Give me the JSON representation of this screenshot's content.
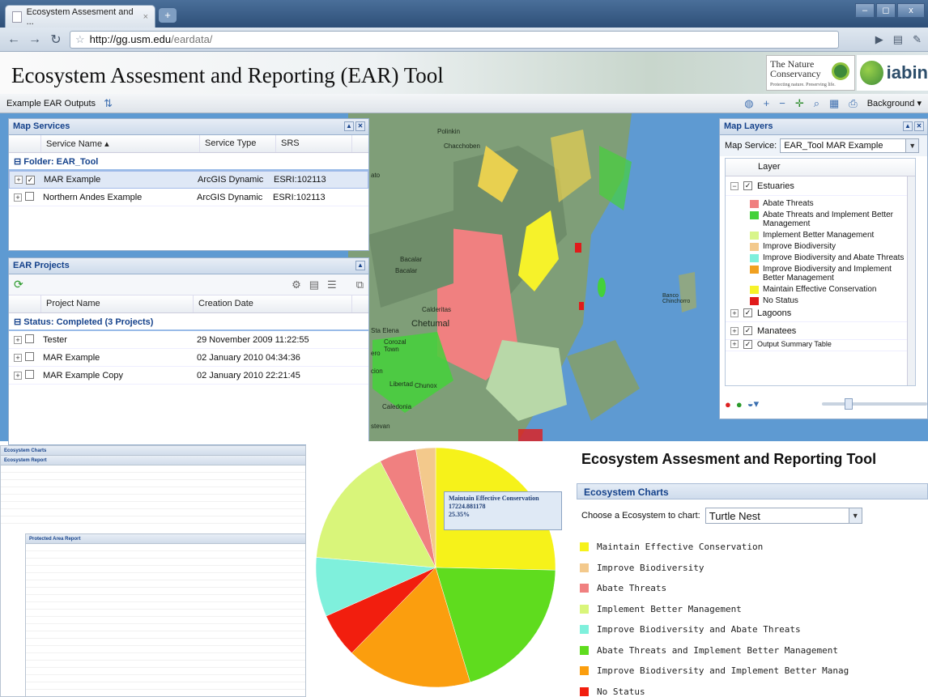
{
  "browser": {
    "tab_title": "Ecosystem Assesment and ...",
    "tab_close": "×",
    "new_tab": "+",
    "window_controls": {
      "minimize": "–",
      "maximize": "◻",
      "close": "x"
    },
    "url_host": "http://gg.usm.edu",
    "url_path": "/eardata/"
  },
  "app": {
    "title": "Ecosystem Assesment and Reporting (EAR) Tool",
    "logos": {
      "tnc_line1": "The Nature",
      "tnc_line2": "Conservancy",
      "tnc_tag": "Protecting nature. Preserving life.",
      "iabin": "iabin"
    },
    "toolbar": {
      "example_outputs": "Example EAR Outputs",
      "background": "Background ▾"
    }
  },
  "map": {
    "labels": [
      "Polinkin",
      "Chacchoben",
      "Bacalar",
      "Bacalar",
      "Calderitas",
      "Chetumal",
      "Sta Elena",
      "Corozal Town",
      "Libertad",
      "Chunox",
      "Caledonia",
      "Banco Chinchorro",
      "ero",
      "cion",
      "stevan",
      "ato"
    ]
  },
  "map_services": {
    "title": "Map Services",
    "columns": [
      "Service Name ▴",
      "Service Type",
      "SRS"
    ],
    "folder": "Folder: EAR_Tool",
    "rows": [
      {
        "name": "MAR Example",
        "type": "ArcGIS Dynamic",
        "srs": "ESRI:102113",
        "checked": true
      },
      {
        "name": "Northern Andes Example",
        "type": "ArcGIS Dynamic",
        "srs": "ESRI:102113",
        "checked": false
      }
    ]
  },
  "ear_projects": {
    "title": "EAR Projects",
    "columns": [
      "Project Name",
      "Creation Date"
    ],
    "group": "Status: Completed (3 Projects)",
    "rows": [
      {
        "name": "Tester",
        "date": "29 November 2009 11:22:55"
      },
      {
        "name": "MAR Example",
        "date": "02 January 2010 04:34:36"
      },
      {
        "name": "MAR Example Copy",
        "date": "02 January 2010 22:21:45"
      }
    ]
  },
  "map_layers": {
    "title": "Map Layers",
    "service_label": "Map Service:",
    "service_value": "EAR_Tool MAR Example",
    "column": "Layer",
    "layers": [
      "Estuaries",
      "Lagoons",
      "Manatees",
      "Output Summary Table"
    ],
    "legend": [
      {
        "label": "Abate Threats",
        "color": "#f08080"
      },
      {
        "label": "Abate Threats and Implement Better Management",
        "color": "#44d13a"
      },
      {
        "label": "Implement Better Management",
        "color": "#d8f58a"
      },
      {
        "label": "Improve Biodiversity",
        "color": "#f3c98c"
      },
      {
        "label": "Improve Biodiversity and Abate Threats",
        "color": "#7ff0dc"
      },
      {
        "label": "Improve Biodiversity and Implement Better Management",
        "color": "#f0a020"
      },
      {
        "label": "Maintain Effective Conservation",
        "color": "#f6f22a"
      },
      {
        "label": "No Status",
        "color": "#e11b1b"
      }
    ]
  },
  "report": {
    "title1": "Ecosystem Charts",
    "title2": "Ecosystem Report",
    "title3": "Protected Area Report"
  },
  "chart_data": {
    "type": "pie",
    "categories": [
      "Maintain Effective Conservation",
      "Abate Threats and Implement Better Management",
      "Improve Biodiversity and Implement Better Management",
      "No Status",
      "Improve Biodiversity and Abate Threats",
      "Implement Better Management",
      "Abate Threats",
      "Improve Biodiversity"
    ],
    "values": [
      25.35,
      20.0,
      17.0,
      6.0,
      8.0,
      16.0,
      5.0,
      2.65
    ],
    "units": "%",
    "colors": [
      "#f6f21a",
      "#5fdc1e",
      "#fb9e0e",
      "#f21e0e",
      "#7ff0dc",
      "#d9f57a",
      "#f08080",
      "#f3c98c"
    ],
    "tooltip": {
      "label": "Maintain Effective Conservation",
      "value": "17224.881178",
      "percent": "25.35%"
    }
  },
  "charts_panel": {
    "title": "Ecosystem Assesment and Reporting Tool",
    "section": "Ecosystem Charts",
    "choose_label": "Choose a Ecosystem to chart:",
    "choose_value": "Turtle Nest",
    "legend": [
      {
        "label": "Maintain Effective Conservation",
        "color": "#f6f21a"
      },
      {
        "label": "Improve Biodiversity",
        "color": "#f3c98c"
      },
      {
        "label": "Abate Threats",
        "color": "#f08080"
      },
      {
        "label": "Implement Better Management",
        "color": "#d9f57a"
      },
      {
        "label": "Improve Biodiversity and Abate Threats",
        "color": "#7ff0dc"
      },
      {
        "label": "Abate Threats and Implement Better Management",
        "color": "#5fdc1e"
      },
      {
        "label": "Improve Biodiversity and Implement Better Manag",
        "color": "#fb9e0e"
      },
      {
        "label": "No Status",
        "color": "#f21e0e"
      }
    ]
  }
}
